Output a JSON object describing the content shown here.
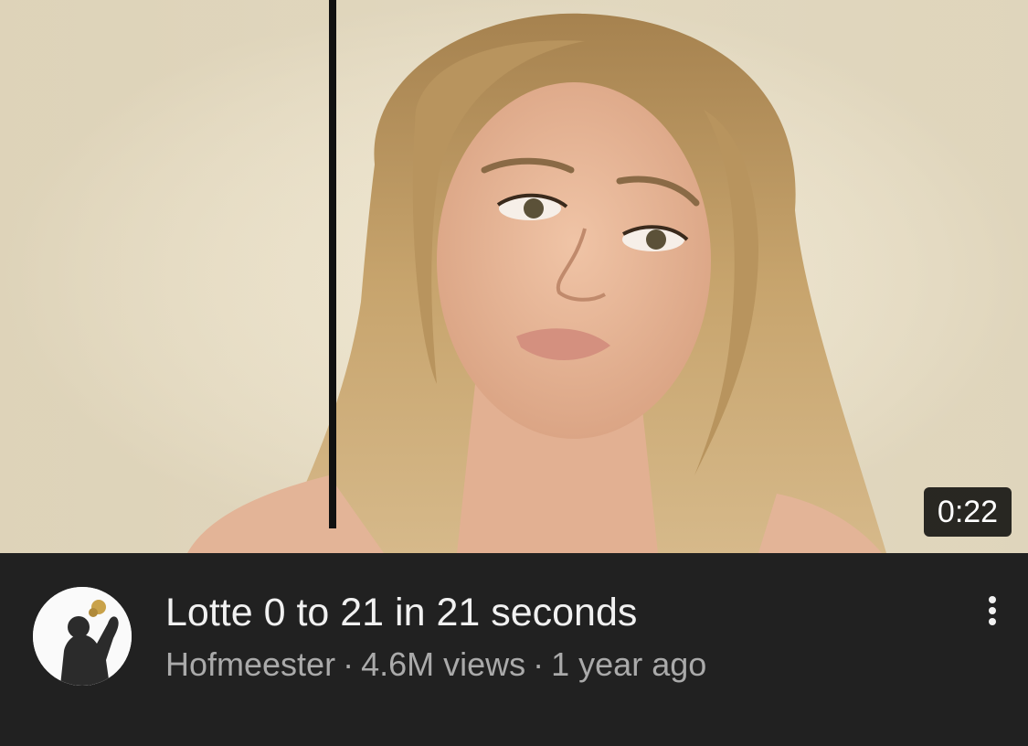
{
  "video": {
    "duration": "0:22",
    "title": "Lotte 0 to 21 in 21 seconds",
    "channel": "Hofmeester",
    "views": "4.6M views",
    "age": "1 year ago",
    "separator": "·"
  },
  "icons": {
    "more": "more-vert-icon",
    "avatar": "channel-avatar"
  },
  "colors": {
    "background": "#212121",
    "title": "#f1f1f1",
    "meta": "#aaaaaa",
    "duration_bg": "#000000"
  }
}
